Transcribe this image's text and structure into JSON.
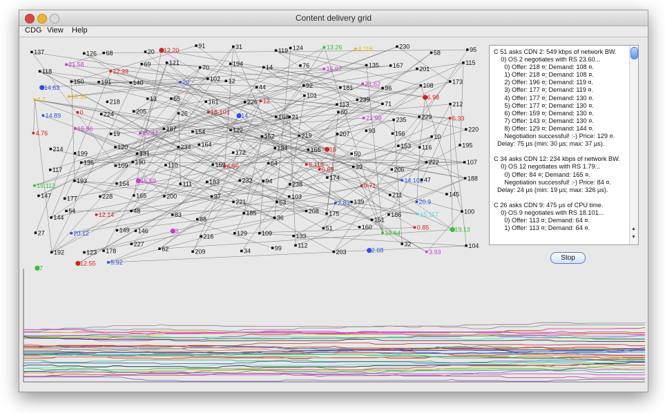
{
  "window": {
    "title": "Content delivery grid"
  },
  "menu": [
    "CDG",
    "View",
    "Help"
  ],
  "graph": {
    "labels": [
      {
        "t": "137",
        "c": "#111111"
      },
      {
        "t": "126",
        "c": "#111111"
      },
      {
        "t": "68",
        "c": "#111111"
      },
      {
        "t": "20",
        "c": "#111111"
      },
      {
        "t": "12.20",
        "c": "#d62020"
      },
      {
        "t": "91",
        "c": "#111111"
      },
      {
        "t": "31",
        "c": "#111111"
      },
      {
        "t": "119",
        "c": "#111111"
      },
      {
        "t": "124",
        "c": "#111111"
      },
      {
        "t": "13.26",
        "c": "#35c035"
      },
      {
        "t": "4.116",
        "c": "#e2b21d"
      },
      {
        "t": "230",
        "c": "#111111"
      },
      {
        "t": "58",
        "c": "#111111"
      },
      {
        "t": "95",
        "c": "#111111"
      },
      {
        "t": "118",
        "c": "#111111"
      },
      {
        "t": "21.58",
        "c": "#cf3ad3"
      },
      {
        "t": "12.39",
        "c": "#d62020"
      },
      {
        "t": "69",
        "c": "#111111"
      },
      {
        "t": "121",
        "c": "#111111"
      },
      {
        "t": "70",
        "c": "#111111"
      },
      {
        "t": "194",
        "c": "#111111"
      },
      {
        "t": "14",
        "c": "#111111"
      },
      {
        "t": "76",
        "c": "#111111"
      },
      {
        "t": "15.97",
        "c": "#cf3ad3"
      },
      {
        "t": "135",
        "c": "#111111"
      },
      {
        "t": "167",
        "c": "#111111"
      },
      {
        "t": "201",
        "c": "#111111"
      },
      {
        "t": "115",
        "c": "#111111"
      },
      {
        "t": "14.63",
        "c": "#2d4fe0"
      },
      {
        "t": "150",
        "c": "#111111"
      },
      {
        "t": "191",
        "c": "#111111"
      },
      {
        "t": "140",
        "c": "#111111"
      },
      {
        "t": "20",
        "c": "#2d4fe0"
      },
      {
        "t": "102",
        "c": "#111111"
      },
      {
        "t": "12",
        "c": "#111111"
      },
      {
        "t": "44",
        "c": "#111111"
      },
      {
        "t": "92",
        "c": "#111111"
      },
      {
        "t": "181",
        "c": "#111111"
      },
      {
        "t": "21.62",
        "c": "#cf3ad3"
      },
      {
        "t": "96",
        "c": "#111111"
      },
      {
        "t": "108",
        "c": "#111111"
      },
      {
        "t": "173",
        "c": "#111111"
      },
      {
        "t": "4.7",
        "c": "#e2b21d"
      },
      {
        "t": "16.36",
        "c": "#e2b21d"
      },
      {
        "t": "218",
        "c": "#111111"
      },
      {
        "t": "13",
        "c": "#111111"
      },
      {
        "t": "65",
        "c": "#111111"
      },
      {
        "t": "161",
        "c": "#111111"
      },
      {
        "t": "226",
        "c": "#111111"
      },
      {
        "t": "12",
        "c": "#d62020"
      },
      {
        "t": "101",
        "c": "#111111"
      },
      {
        "t": "113",
        "c": "#111111"
      },
      {
        "t": "239",
        "c": "#111111"
      },
      {
        "t": "71",
        "c": "#111111"
      },
      {
        "t": "6.98",
        "c": "#d62020"
      },
      {
        "t": "212",
        "c": "#111111"
      },
      {
        "t": "14.89",
        "c": "#2d4fe0"
      },
      {
        "t": "0",
        "c": "#d62020"
      },
      {
        "t": "224",
        "c": "#111111"
      },
      {
        "t": "205",
        "c": "#111111"
      },
      {
        "t": "26",
        "c": "#111111"
      },
      {
        "t": "18.101",
        "c": "#d62020"
      },
      {
        "t": "14",
        "c": "#2d4fe0"
      },
      {
        "t": "168",
        "c": "#111111"
      },
      {
        "t": "21",
        "c": "#111111"
      },
      {
        "t": "60",
        "c": "#111111"
      },
      {
        "t": "21.99",
        "c": "#cf3ad3"
      },
      {
        "t": "235",
        "c": "#111111"
      },
      {
        "t": "229",
        "c": "#111111"
      },
      {
        "t": "6.33",
        "c": "#d62020"
      },
      {
        "t": "4.76",
        "c": "#d62020"
      },
      {
        "t": "15.96",
        "c": "#cf3ad3"
      },
      {
        "t": "19",
        "c": "#111111"
      },
      {
        "t": "15.47",
        "c": "#cf3ad3"
      },
      {
        "t": "187",
        "c": "#111111"
      },
      {
        "t": "154",
        "c": "#111111"
      },
      {
        "t": "122",
        "c": "#111111"
      },
      {
        "t": "152",
        "c": "#111111"
      },
      {
        "t": "219",
        "c": "#111111"
      },
      {
        "t": "207",
        "c": "#111111"
      },
      {
        "t": "93",
        "c": "#111111"
      },
      {
        "t": "156",
        "c": "#111111"
      },
      {
        "t": "10",
        "c": "#111111"
      },
      {
        "t": "220",
        "c": "#111111"
      },
      {
        "t": "214",
        "c": "#111111"
      },
      {
        "t": "199",
        "c": "#111111"
      },
      {
        "t": "120",
        "c": "#111111"
      },
      {
        "t": "131",
        "c": "#111111"
      },
      {
        "t": "234",
        "c": "#111111"
      },
      {
        "t": "164",
        "c": "#111111"
      },
      {
        "t": "172",
        "c": "#111111"
      },
      {
        "t": "134",
        "c": "#111111"
      },
      {
        "t": "166",
        "c": "#111111"
      },
      {
        "t": "18",
        "c": "#d62020"
      },
      {
        "t": "50",
        "c": "#111111"
      },
      {
        "t": "153",
        "c": "#111111"
      },
      {
        "t": "116",
        "c": "#111111"
      },
      {
        "t": "195",
        "c": "#111111"
      },
      {
        "t": "117",
        "c": "#111111"
      },
      {
        "t": "136",
        "c": "#111111"
      },
      {
        "t": "109",
        "c": "#111111"
      },
      {
        "t": "190",
        "c": "#111111"
      },
      {
        "t": "110",
        "c": "#111111"
      },
      {
        "t": "159",
        "c": "#111111"
      },
      {
        "t": "6.95",
        "c": "#d62020"
      },
      {
        "t": "64",
        "c": "#111111"
      },
      {
        "t": "6.118",
        "c": "#d62020"
      },
      {
        "t": "0.69",
        "c": "#d62020"
      },
      {
        "t": "39",
        "c": "#111111"
      },
      {
        "t": "206",
        "c": "#111111"
      },
      {
        "t": "222",
        "c": "#111111"
      },
      {
        "t": "107",
        "c": "#111111"
      },
      {
        "t": "19.113",
        "c": "#35c035"
      },
      {
        "t": "193",
        "c": "#111111"
      },
      {
        "t": "164",
        "c": "#111111"
      },
      {
        "t": "15.59",
        "c": "#cf3ad3"
      },
      {
        "t": "111",
        "c": "#111111"
      },
      {
        "t": "183",
        "c": "#111111"
      },
      {
        "t": "232",
        "c": "#111111"
      },
      {
        "t": "94",
        "c": "#111111"
      },
      {
        "t": "238",
        "c": "#111111"
      },
      {
        "t": "174",
        "c": "#111111"
      },
      {
        "t": "0.71",
        "c": "#d62020"
      },
      {
        "t": "14.102",
        "c": "#2d4fe0"
      },
      {
        "t": "47",
        "c": "#111111"
      },
      {
        "t": "188",
        "c": "#111111"
      },
      {
        "t": "147",
        "c": "#111111"
      },
      {
        "t": "177",
        "c": "#111111"
      },
      {
        "t": "228",
        "c": "#111111"
      },
      {
        "t": "165",
        "c": "#111111"
      },
      {
        "t": "200",
        "c": "#111111"
      },
      {
        "t": "97",
        "c": "#111111"
      },
      {
        "t": "221",
        "c": "#111111"
      },
      {
        "t": "63",
        "c": "#111111"
      },
      {
        "t": "103",
        "c": "#111111"
      },
      {
        "t": "2.83",
        "c": "#2d4fe0"
      },
      {
        "t": "139",
        "c": "#111111"
      },
      {
        "t": "211",
        "c": "#111111"
      },
      {
        "t": "20.9",
        "c": "#2d4fe0"
      },
      {
        "t": "145",
        "c": "#111111"
      },
      {
        "t": "144",
        "c": "#111111"
      },
      {
        "t": "54",
        "c": "#111111"
      },
      {
        "t": "12.14",
        "c": "#d62020"
      },
      {
        "t": "48",
        "c": "#111111"
      },
      {
        "t": "83",
        "c": "#111111"
      },
      {
        "t": "88",
        "c": "#111111"
      },
      {
        "t": "185",
        "c": "#111111"
      },
      {
        "t": "36",
        "c": "#111111"
      },
      {
        "t": "208",
        "c": "#111111"
      },
      {
        "t": "175",
        "c": "#111111"
      },
      {
        "t": "151",
        "c": "#111111"
      },
      {
        "t": "186",
        "c": "#111111"
      },
      {
        "t": "15.117",
        "c": "#4fd8e0"
      },
      {
        "t": "100",
        "c": "#111111"
      },
      {
        "t": "27",
        "c": "#111111"
      },
      {
        "t": "20.12",
        "c": "#2d4fe0"
      },
      {
        "t": "149",
        "c": "#111111"
      },
      {
        "t": "146",
        "c": "#111111"
      },
      {
        "t": "3",
        "c": "#cf3ad3"
      },
      {
        "t": "216",
        "c": "#111111"
      },
      {
        "t": "129",
        "c": "#111111"
      },
      {
        "t": "109",
        "c": "#111111"
      },
      {
        "t": "133",
        "c": "#111111"
      },
      {
        "t": "51",
        "c": "#111111"
      },
      {
        "t": "160",
        "c": "#111111"
      },
      {
        "t": "19.64",
        "c": "#35c035"
      },
      {
        "t": "0.85",
        "c": "#d62020"
      },
      {
        "t": "19.13",
        "c": "#35c035"
      },
      {
        "t": "192",
        "c": "#111111"
      },
      {
        "t": "123",
        "c": "#111111"
      },
      {
        "t": "178",
        "c": "#111111"
      },
      {
        "t": "227",
        "c": "#111111"
      },
      {
        "t": "62",
        "c": "#111111"
      },
      {
        "t": "209",
        "c": "#111111"
      },
      {
        "t": "34",
        "c": "#111111"
      },
      {
        "t": "99",
        "c": "#111111"
      },
      {
        "t": "112",
        "c": "#111111"
      },
      {
        "t": "203",
        "c": "#111111"
      },
      {
        "t": "2.68",
        "c": "#2d4fe0"
      },
      {
        "t": "32",
        "c": "#111111"
      },
      {
        "t": "3.93",
        "c": "#cf3ad3"
      },
      {
        "t": "104",
        "c": "#111111"
      },
      {
        "t": "7",
        "c": "#35c035"
      },
      {
        "t": "12.55",
        "c": "#d62020"
      },
      {
        "t": "5.92",
        "c": "#2d4fe0"
      }
    ]
  },
  "log": {
    "text": "C 51 asks CDN 2: 549 kbps of network BW.\n    0) OS 2 negotiates with RS 23.60...\n      0) Offer: 218 ¤; Demand: 108 ¤.\n      1) Offer: 218 ¤; Demand: 108 ¤.\n      2) Offer: 196 ¤; Demand: 119 ¤.\n      3) Offer: 177 ¤; Demand: 119 ¤.\n      4) Offer: 177 ¤; Demand: 130 ¤.\n      5) Offer: 177 ¤; Demand: 130 ¤.\n      6) Offer: 159 ¤; Demand: 130 ¤.\n      7) Offer: 143 ¤; Demand: 130 ¤.\n      8) Offer: 129 ¤; Demand: 144 ¤.\n      Negotiation successful! :-) Price: 129 ¤.\n  Delay: 75 µs (min: 30 µs; max: 37 µs).\n\nC 34 asks CDN 12: 234 kbps of network BW.\n    0) OS 12 negotiates with RS 1.79...\n      0) Offer: 84 ¤; Demand: 165 ¤.\n      Negotiation successful! :-) Price: 84 ¤.\n  Delay: 24 µs (min: 19 µs; max: 326 µs).\n\nC 26 asks CDN 9: 475 µs of CPU time.\n    0) OS 9 negotiates with RS 18.101...\n      0) Offer: 113 ¤; Demand: 64 ¤.\n      1) Offer: 113 ¤; Demand: 64 ¤."
  },
  "controls": {
    "stop_label": "Stop"
  }
}
